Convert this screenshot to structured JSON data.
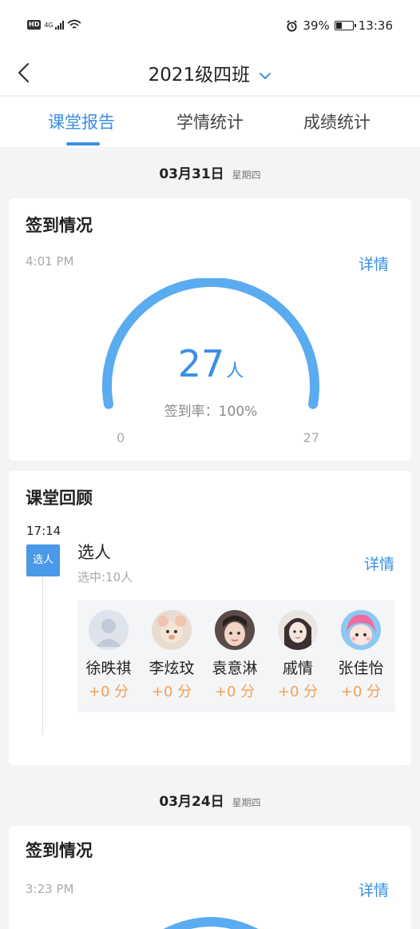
{
  "status_bar": {
    "hd": "HD",
    "network": "4G",
    "battery": "39%",
    "battery_level": 0.39,
    "time": "13:36"
  },
  "nav": {
    "class_name": "2021级四班"
  },
  "tabs": [
    {
      "label": "课堂报告",
      "active": true
    },
    {
      "label": "学情统计",
      "active": false
    },
    {
      "label": "成绩统计",
      "active": false
    }
  ],
  "days": [
    {
      "date": "03月31日",
      "weekday": "星期四",
      "attendance": {
        "title": "签到情况",
        "time": "4:01 PM",
        "detail": "详情",
        "count": "27",
        "unit": "人",
        "rate_label": "签到率：100%",
        "min": "0",
        "max": "27",
        "rate": 1.0
      },
      "review": {
        "title": "课堂回顾",
        "time": "17:14",
        "badge": "选人",
        "event_title": "选人",
        "event_sub": "选中:10人",
        "detail": "详情",
        "students": [
          {
            "name": "徐昳祺",
            "score": "+0 分"
          },
          {
            "name": "李炫玟",
            "score": "+0 分"
          },
          {
            "name": "袁意淋",
            "score": "+0 分"
          },
          {
            "name": "戚情",
            "score": "+0 分"
          },
          {
            "name": "张佳怡",
            "score": "+0 分"
          }
        ]
      }
    },
    {
      "date": "03月24日",
      "weekday": "星期四",
      "attendance": {
        "title": "签到情况",
        "time": "3:23 PM",
        "detail": "详情"
      }
    }
  ],
  "colors": {
    "accent": "#3a8ee6",
    "gauge": "#5aabf0",
    "score": "#f0a055"
  }
}
